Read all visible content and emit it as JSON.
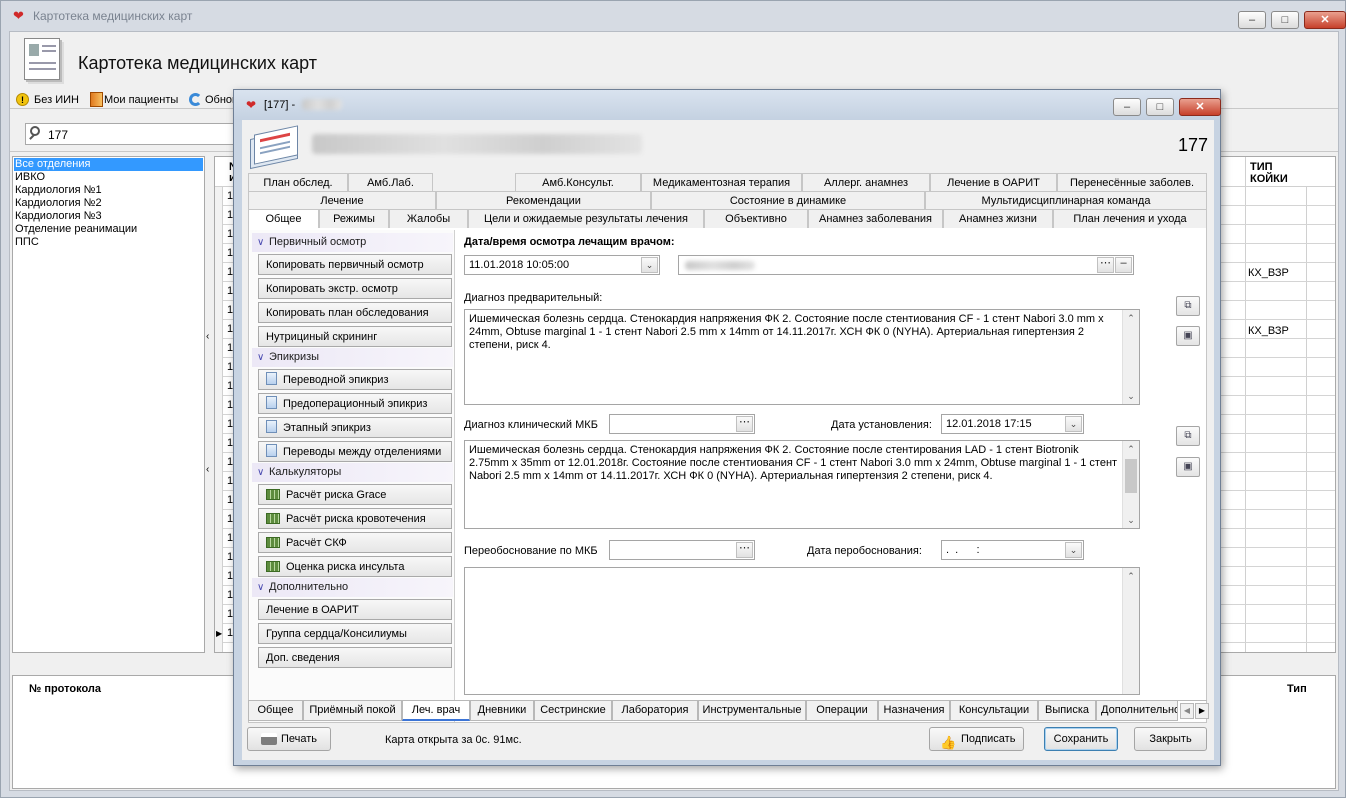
{
  "main_window": {
    "title": "Картотека медицинских карт",
    "header_title": "Картотека медицинских карт",
    "toolbar": {
      "no_iin": "Без ИИН",
      "my_patients": "Мои пациенты",
      "refresh": "Обнов"
    },
    "search_value": "177",
    "departments": [
      "Все отделения",
      "ИВКО",
      "Кардиология №1",
      "Кардиология №2",
      "Кардиология №3",
      "Отделение реанимации",
      "ППС"
    ],
    "grid_col_left": "№ и",
    "grid_row_prefix": "1",
    "grid_col_bed_type": "ТИП КОЙКИ",
    "bed_types": [
      "КХ_ВЗР",
      "КХ_ВЗР"
    ],
    "bottom_col_protocol": "№ протокола",
    "bottom_col_type": "Тип"
  },
  "dialog": {
    "title": "[177] -",
    "card_number": "177",
    "tabs_row1": [
      "План обслед.",
      "Амб.Лаб.",
      "Амб.Консульт.",
      "Медикаментозная терапия",
      "Аллерг. анамнез",
      "Лечение в ОАРИТ",
      "Перенесённые заболев."
    ],
    "tabs_row2": [
      "Лечение",
      "Рекомендации",
      "Состояние в динамике",
      "Мультидисциплинарная команда"
    ],
    "tabs_row3": [
      "Общее",
      "Режимы",
      "Жалобы",
      "Цели и ожидаемые результаты лечения",
      "Объективно",
      "Анамнез заболевания",
      "Анамнез жизни",
      "План лечения и ухода"
    ],
    "nav": {
      "group1": "Первичный осмотр",
      "group1_items": [
        "Копировать первичный осмотр",
        "Копировать экстр. осмотр",
        "Копировать план обследования",
        "Нутрициный скрининг"
      ],
      "group2": "Эпикризы",
      "group2_items": [
        "Переводной эпикриз",
        "Предоперационный эпикриз",
        "Этапный эпикриз",
        "Переводы между отделениями"
      ],
      "group3": "Калькуляторы",
      "group3_items": [
        "Расчёт риска Grace",
        "Расчёт риска кровотечения",
        "Расчёт СКФ",
        "Оценка риска инсульта"
      ],
      "group4": "Дополнительно",
      "group4_items": [
        "Лечение в ОАРИТ",
        "Группа сердца/Консилиумы",
        "Доп. сведения"
      ]
    },
    "form": {
      "exam_datetime_label": "Дата/время осмотра лечащим врачом:",
      "exam_datetime_value": "11.01.2018 10:05:00",
      "prelim_diag_label": "Диагноз  предварительный:",
      "prelim_diag_text": "Ишемическая болезнь сердца. Стенокардия напряжения ФК 2. Состояние после стентиования CF - 1 стент Nabori 3.0 mm x 24mm, Obtuse marginal 1 - 1 стент Nabori 2.5 mm x 14mm от 14.11.2017г. ХСН ФК 0 (NYHA). Артериальная гипертензия 2 степени, риск 4.",
      "clin_mkb_label": "Диагноз  клинический МКБ",
      "est_date_label": "Дата установления:",
      "est_date_value": "12.01.2018 17:15",
      "clin_diag_text": "Ишемическая болезнь сердца. Стенокардия напряжения ФК 2. Состояние после стентирования LAD - 1 стент Biotronik 2.75mm x 35mm от 12.01.2018г. Состояние после стентиования CF - 1 стент Nabori 3.0 mm x 24mm, Obtuse marginal 1 - 1 стент Nabori 2.5 mm x 14mm от 14.11.2017г. ХСН ФК 0 (NYHA). Артериальная гипертензия 2 степени, риск 4.",
      "rejust_label": "Переобоснование по МКБ",
      "rejust_date_label": "Дата перобоснования:",
      "rejust_date_value": ".  .      :"
    },
    "bottom_tabs": [
      "Общее",
      "Приёмный покой",
      "Леч. врач",
      "Дневники",
      "Сестринские",
      "Лаборатория",
      "Инструментальные",
      "Операции",
      "Назначения",
      "Консультации",
      "Выписка",
      "Дополнительно"
    ],
    "active_bottom_tab": "Леч. врач",
    "footer": {
      "print": "Печать",
      "status": "Карта открыта за 0с. 91мс.",
      "sign": "Подписать",
      "save": "Сохранить",
      "close": "Закрыть"
    }
  },
  "colors": {
    "accent": "#3399ff",
    "selection": "#3399ff",
    "nav_header_bg": "#e8e4f4"
  }
}
